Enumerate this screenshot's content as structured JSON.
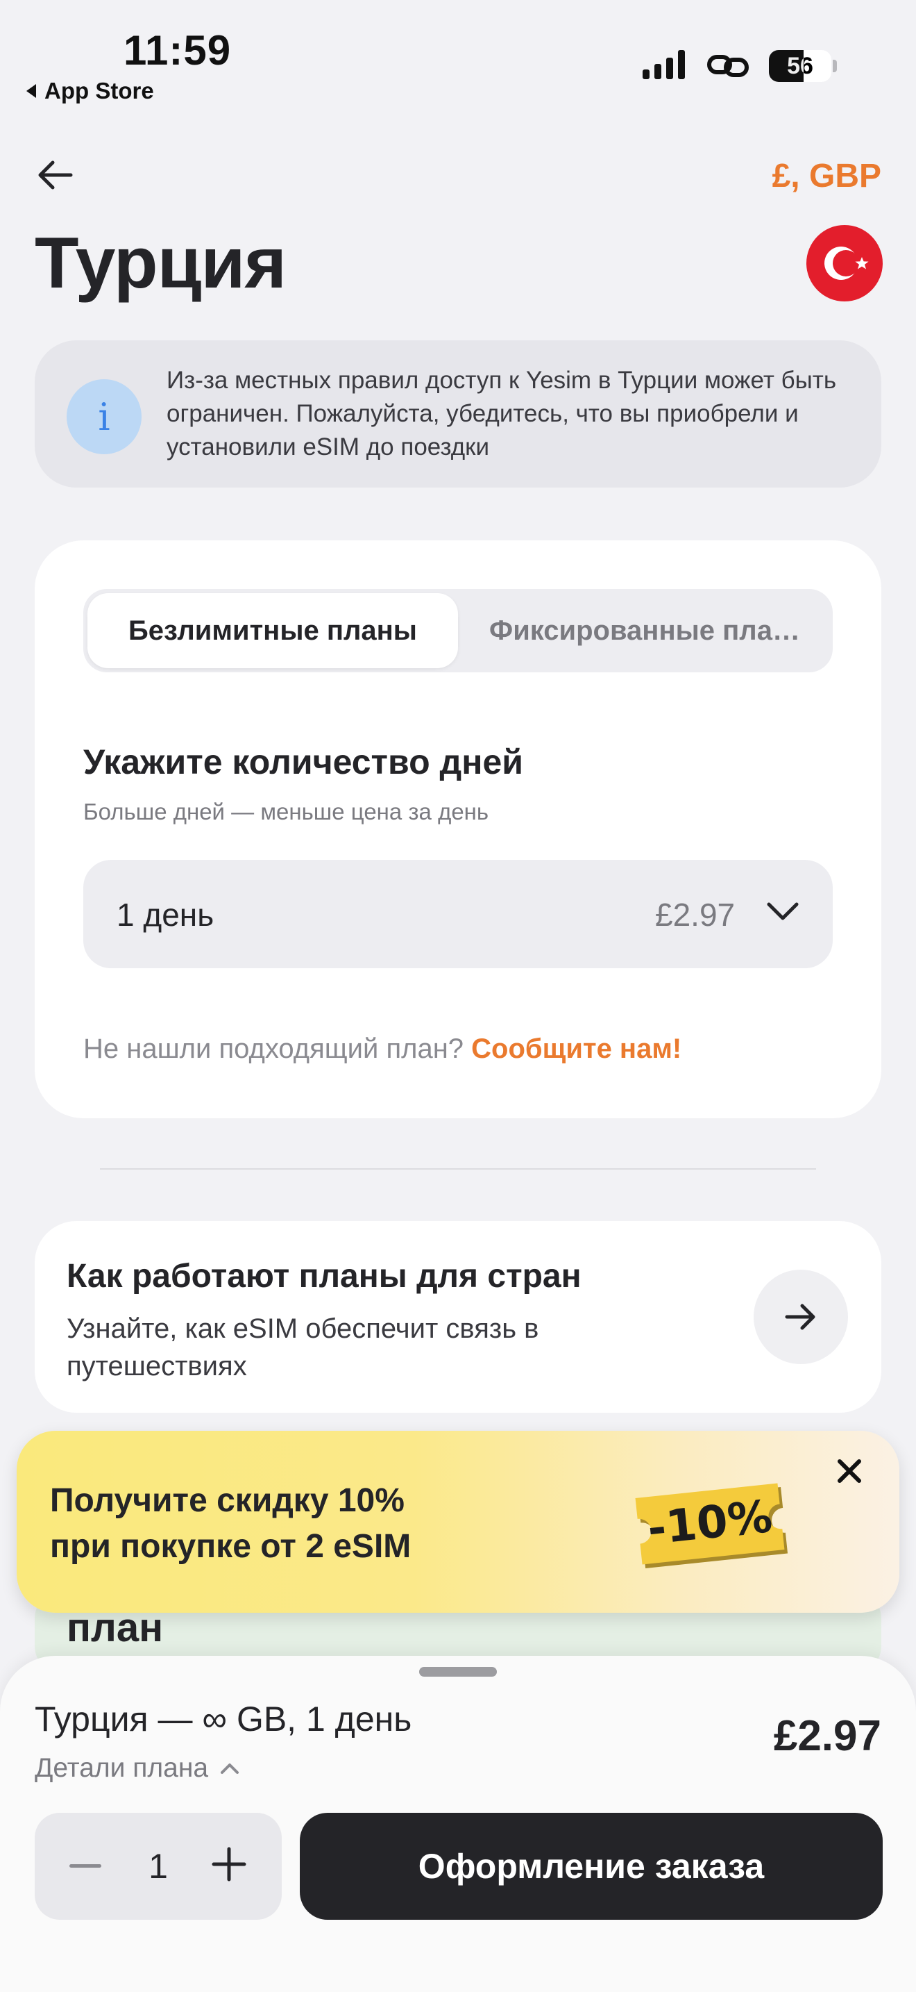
{
  "status_bar": {
    "time": "11:59",
    "back_app": "App Store",
    "battery": "56"
  },
  "header": {
    "currency": "£, GBP",
    "title": "Турция"
  },
  "info_banner": {
    "icon": "i",
    "text": "Из-за местных правил доступ к Yesim в Турции может быть ограничен. Пожалуйста, убедитесь, что вы приобрели и установили eSIM до поездки"
  },
  "plans": {
    "tabs": [
      {
        "label": "Безлимитные планы",
        "active": true
      },
      {
        "label": "Фиксированные пла…",
        "active": false
      }
    ],
    "days_title": "Укажите количество дней",
    "days_subtitle": "Больше дней — меньше цена за день",
    "selected": {
      "label": "1 день",
      "price": "£2.97"
    },
    "not_found": "Не нашли подходящий план?",
    "not_found_link": "Сообщите нам!"
  },
  "how_it_works": {
    "title": "Как работают планы для стран",
    "subtitle": "Узнайте, как eSIM обеспечит связь в путешествиях"
  },
  "peek_text": "план",
  "promo": {
    "line1": "Получите скидку 10%",
    "line2": "при покупке от 2 eSIM",
    "badge": "-10%"
  },
  "bottom_sheet": {
    "plan_name": "Турция — ∞ GB, 1 день",
    "details_label": "Детали плана",
    "price": "£2.97",
    "quantity": "1",
    "order_label": "Оформление заказа"
  },
  "colors": {
    "accent": "#ea7a2e",
    "dark": "#242428",
    "flag": "#e31e2c",
    "info_icon": "#3a82e6"
  }
}
